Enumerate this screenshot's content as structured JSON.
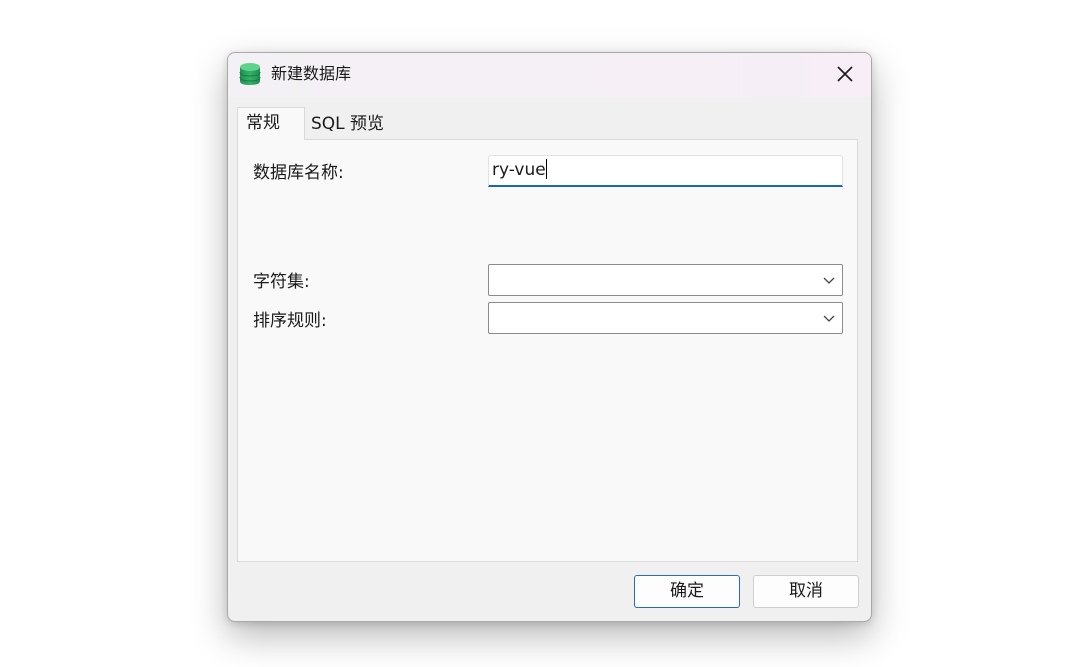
{
  "window": {
    "title": "新建数据库",
    "icon": "database-icon",
    "accent_color": "#1a66b8"
  },
  "tabs": [
    {
      "label": "常规",
      "active": true
    },
    {
      "label": "SQL 预览",
      "active": false
    }
  ],
  "form": {
    "db_name": {
      "label": "数据库名称:",
      "value": "ry-vue"
    },
    "charset": {
      "label": "字符集:",
      "value": ""
    },
    "collation": {
      "label": "排序规则:",
      "value": ""
    }
  },
  "buttons": {
    "ok": "确定",
    "cancel": "取消"
  }
}
